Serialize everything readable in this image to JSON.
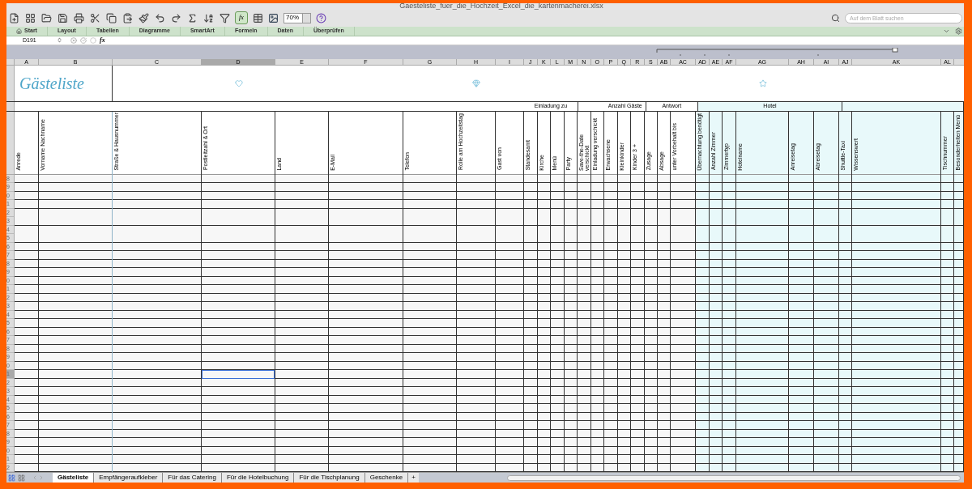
{
  "window": {
    "title": "Gaesteliste_fuer_die_Hochzeit_Excel_die_kartenmacherei.xlsx"
  },
  "toolbar": {
    "formula_button": "fx",
    "zoom": "70%",
    "search": {
      "placeholder": "Auf dem Blatt suchen"
    }
  },
  "ribbon_tabs": [
    "Start",
    "Layout",
    "Tabellen",
    "Diagramme",
    "SmartArt",
    "Formeln",
    "Daten",
    "Überprüfen"
  ],
  "formula_bar": {
    "cell": "D191",
    "fx": "fx"
  },
  "sheet": {
    "title": "Gästeliste",
    "column_groups": [
      {
        "highlighted": false,
        "columns": [
          {
            "letter": "A",
            "heading": "Anrede",
            "selected": false
          },
          {
            "letter": "B",
            "heading": "Vorname Nachname",
            "selected": false
          },
          {
            "letter": "C",
            "heading": "Straße & Hausnummer",
            "selected": false
          },
          {
            "letter": "D",
            "heading": "Postleitzahl & Ort",
            "selected": true
          },
          {
            "letter": "E",
            "heading": "Land",
            "selected": false
          },
          {
            "letter": "F",
            "heading": "E-Mail",
            "selected": false
          },
          {
            "letter": "G",
            "heading": "Telefon",
            "selected": false
          },
          {
            "letter": "H",
            "heading": "Rolle am Hochzeitstag",
            "selected": false
          },
          {
            "letter": "I",
            "heading": "Gast von",
            "selected": false
          }
        ]
      },
      {
        "label": "Einladung zu",
        "highlighted": false,
        "columns": [
          {
            "letter": "J",
            "heading": "Standesamt",
            "selected": false
          },
          {
            "letter": "K",
            "heading": "Kirche",
            "selected": false
          },
          {
            "letter": "L",
            "heading": "Menü",
            "selected": false
          },
          {
            "letter": "M",
            "heading": "Party",
            "selected": false
          }
        ]
      },
      {
        "highlighted": false,
        "columns": [
          {
            "letter": "N",
            "heading": "Save-the-Date verschickt",
            "selected": false
          },
          {
            "letter": "O",
            "heading": "Einladung verschickt",
            "selected": false
          }
        ]
      },
      {
        "label": "Anzahl Gäste",
        "highlighted": false,
        "columns": [
          {
            "letter": "P",
            "heading": "Erwachsene",
            "selected": false
          },
          {
            "letter": "Q",
            "heading": "Kleinkinder",
            "selected": false
          },
          {
            "letter": "R",
            "heading": "Kinder 3 +",
            "selected": false
          }
        ]
      },
      {
        "label": "Antwort",
        "highlighted": false,
        "columns": [
          {
            "letter": "S",
            "heading": "Zusage",
            "selected": false
          },
          {
            "letter": "AB",
            "heading": "Absage",
            "selected": false
          },
          {
            "letter": "AC",
            "heading": "unter Vorbehalt bis",
            "selected": false
          }
        ]
      },
      {
        "label": "Hotel",
        "highlighted": true,
        "columns": [
          {
            "letter": "AD",
            "heading": "Übernachtung benötigt",
            "selected": false
          },
          {
            "letter": "AE",
            "heading": "Anzahl Zimmer",
            "selected": false
          },
          {
            "letter": "AF",
            "heading": "Zimmertyp",
            "selected": false
          },
          {
            "letter": "AG",
            "heading": "Hotelname",
            "selected": false
          },
          {
            "letter": "AH",
            "heading": "Anreisetag",
            "selected": false
          },
          {
            "letter": "AI",
            "heading": "Abreisetag",
            "selected": false
          }
        ]
      },
      {
        "highlighted": true,
        "columns": [
          {
            "letter": "AJ",
            "heading": "Shuttle-Taxi",
            "selected": false
          },
          {
            "letter": "AK",
            "heading": "Wissenswert",
            "selected": false
          },
          {
            "letter": "AL",
            "heading": "Tischnummer",
            "selected": false
          },
          {
            "heading": "Besonderheiten Menü",
            "selected": false
          }
        ]
      }
    ],
    "rows": [
      {
        "label": "8",
        "selected": false
      },
      {
        "label": "9",
        "selected": false
      },
      {
        "label": "0",
        "selected": false
      },
      {
        "label": "1",
        "selected": false
      },
      {
        "label": "2",
        "selected": false
      },
      {
        "label": "3",
        "selected": false
      },
      {
        "label": "4",
        "selected": false
      },
      {
        "label": "5",
        "selected": false
      },
      {
        "label": "6",
        "selected": false
      },
      {
        "label": "7",
        "selected": false
      },
      {
        "label": "8",
        "selected": false
      },
      {
        "label": "9",
        "selected": false
      },
      {
        "label": "0",
        "selected": false
      },
      {
        "label": "1",
        "selected": false
      },
      {
        "label": "2",
        "selected": false
      },
      {
        "label": "3",
        "selected": false
      },
      {
        "label": "4",
        "selected": false
      },
      {
        "label": "5",
        "selected": false
      },
      {
        "label": "6",
        "selected": false
      },
      {
        "label": "7",
        "selected": false
      },
      {
        "label": "8",
        "selected": false
      },
      {
        "label": "9",
        "selected": false
      },
      {
        "label": "0",
        "selected": false
      },
      {
        "label": "1",
        "selected": true
      },
      {
        "label": "2",
        "selected": false
      },
      {
        "label": "3",
        "selected": false
      },
      {
        "label": "4",
        "selected": false
      },
      {
        "label": "5",
        "selected": false
      },
      {
        "label": "6",
        "selected": false
      },
      {
        "label": "7",
        "selected": false
      },
      {
        "label": "8",
        "selected": false
      },
      {
        "label": "9",
        "selected": false
      },
      {
        "label": "0",
        "selected": false
      },
      {
        "label": "1",
        "selected": false
      },
      {
        "label": "2",
        "selected": false
      }
    ]
  },
  "sheet_tabs": [
    {
      "label": "Gästeliste",
      "selected": true
    },
    {
      "label": "Empfängeraufkleber",
      "selected": false
    },
    {
      "label": "Für das Catering",
      "selected": false
    },
    {
      "label": "Für die Hotelbuchung",
      "selected": false
    },
    {
      "label": "Für die Tischplanung",
      "selected": false
    },
    {
      "label": "Geschenke",
      "selected": false
    }
  ],
  "add_sheet": "+"
}
